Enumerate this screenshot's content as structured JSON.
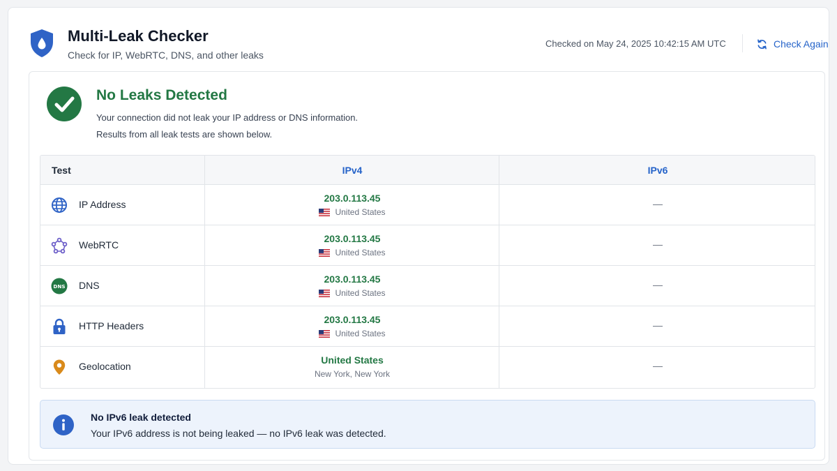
{
  "header": {
    "title": "Multi-Leak Checker",
    "subtitle": "Check for IP, WebRTC, DNS, and other leaks",
    "checked_on": "Checked on May 24, 2025 10:42:15 AM UTC",
    "check_again_label": "Check Again",
    "icons": {
      "logo": "shield-drop-icon",
      "refresh": "refresh-icon"
    }
  },
  "status": {
    "title": "No Leaks Detected",
    "line1": "Your connection did not leak your IP address or DNS information.",
    "line2": "Results from all leak tests are shown below.",
    "icon": "check-circle-icon"
  },
  "table": {
    "columns": [
      "Test",
      "IPv4",
      "IPv6"
    ],
    "rows": [
      {
        "icon": "globe-icon",
        "test": "IP Address",
        "ipv4_main": "203.0.113.45",
        "ipv4_sub": "United States",
        "flag": "us-flag-icon",
        "ipv6": "—"
      },
      {
        "icon": "webrtc-icon",
        "test": "WebRTC",
        "ipv4_main": "203.0.113.45",
        "ipv4_sub": "United States",
        "flag": "us-flag-icon",
        "ipv6": "—"
      },
      {
        "icon": "dns-icon",
        "test": "DNS",
        "ipv4_main": "203.0.113.45",
        "ipv4_sub": "United States",
        "flag": "us-flag-icon",
        "ipv6": "—"
      },
      {
        "icon": "lock-icon",
        "test": "HTTP Headers",
        "ipv4_main": "203.0.113.45",
        "ipv4_sub": "United States",
        "flag": "us-flag-icon",
        "ipv6": "—"
      },
      {
        "icon": "location-pin-icon",
        "test": "Geolocation",
        "ipv4_main": "United States",
        "ipv4_sub": "New York, New York",
        "flag": null,
        "ipv6": "—"
      }
    ]
  },
  "info": {
    "title": "No IPv6 leak detected",
    "text": "Your IPv6 address is not being leaked — no IPv6 leak was detected.",
    "icon": "info-icon"
  },
  "colors": {
    "accent_blue": "#2563c9",
    "success_green": "#237844",
    "info_bg": "#edf3fc"
  }
}
